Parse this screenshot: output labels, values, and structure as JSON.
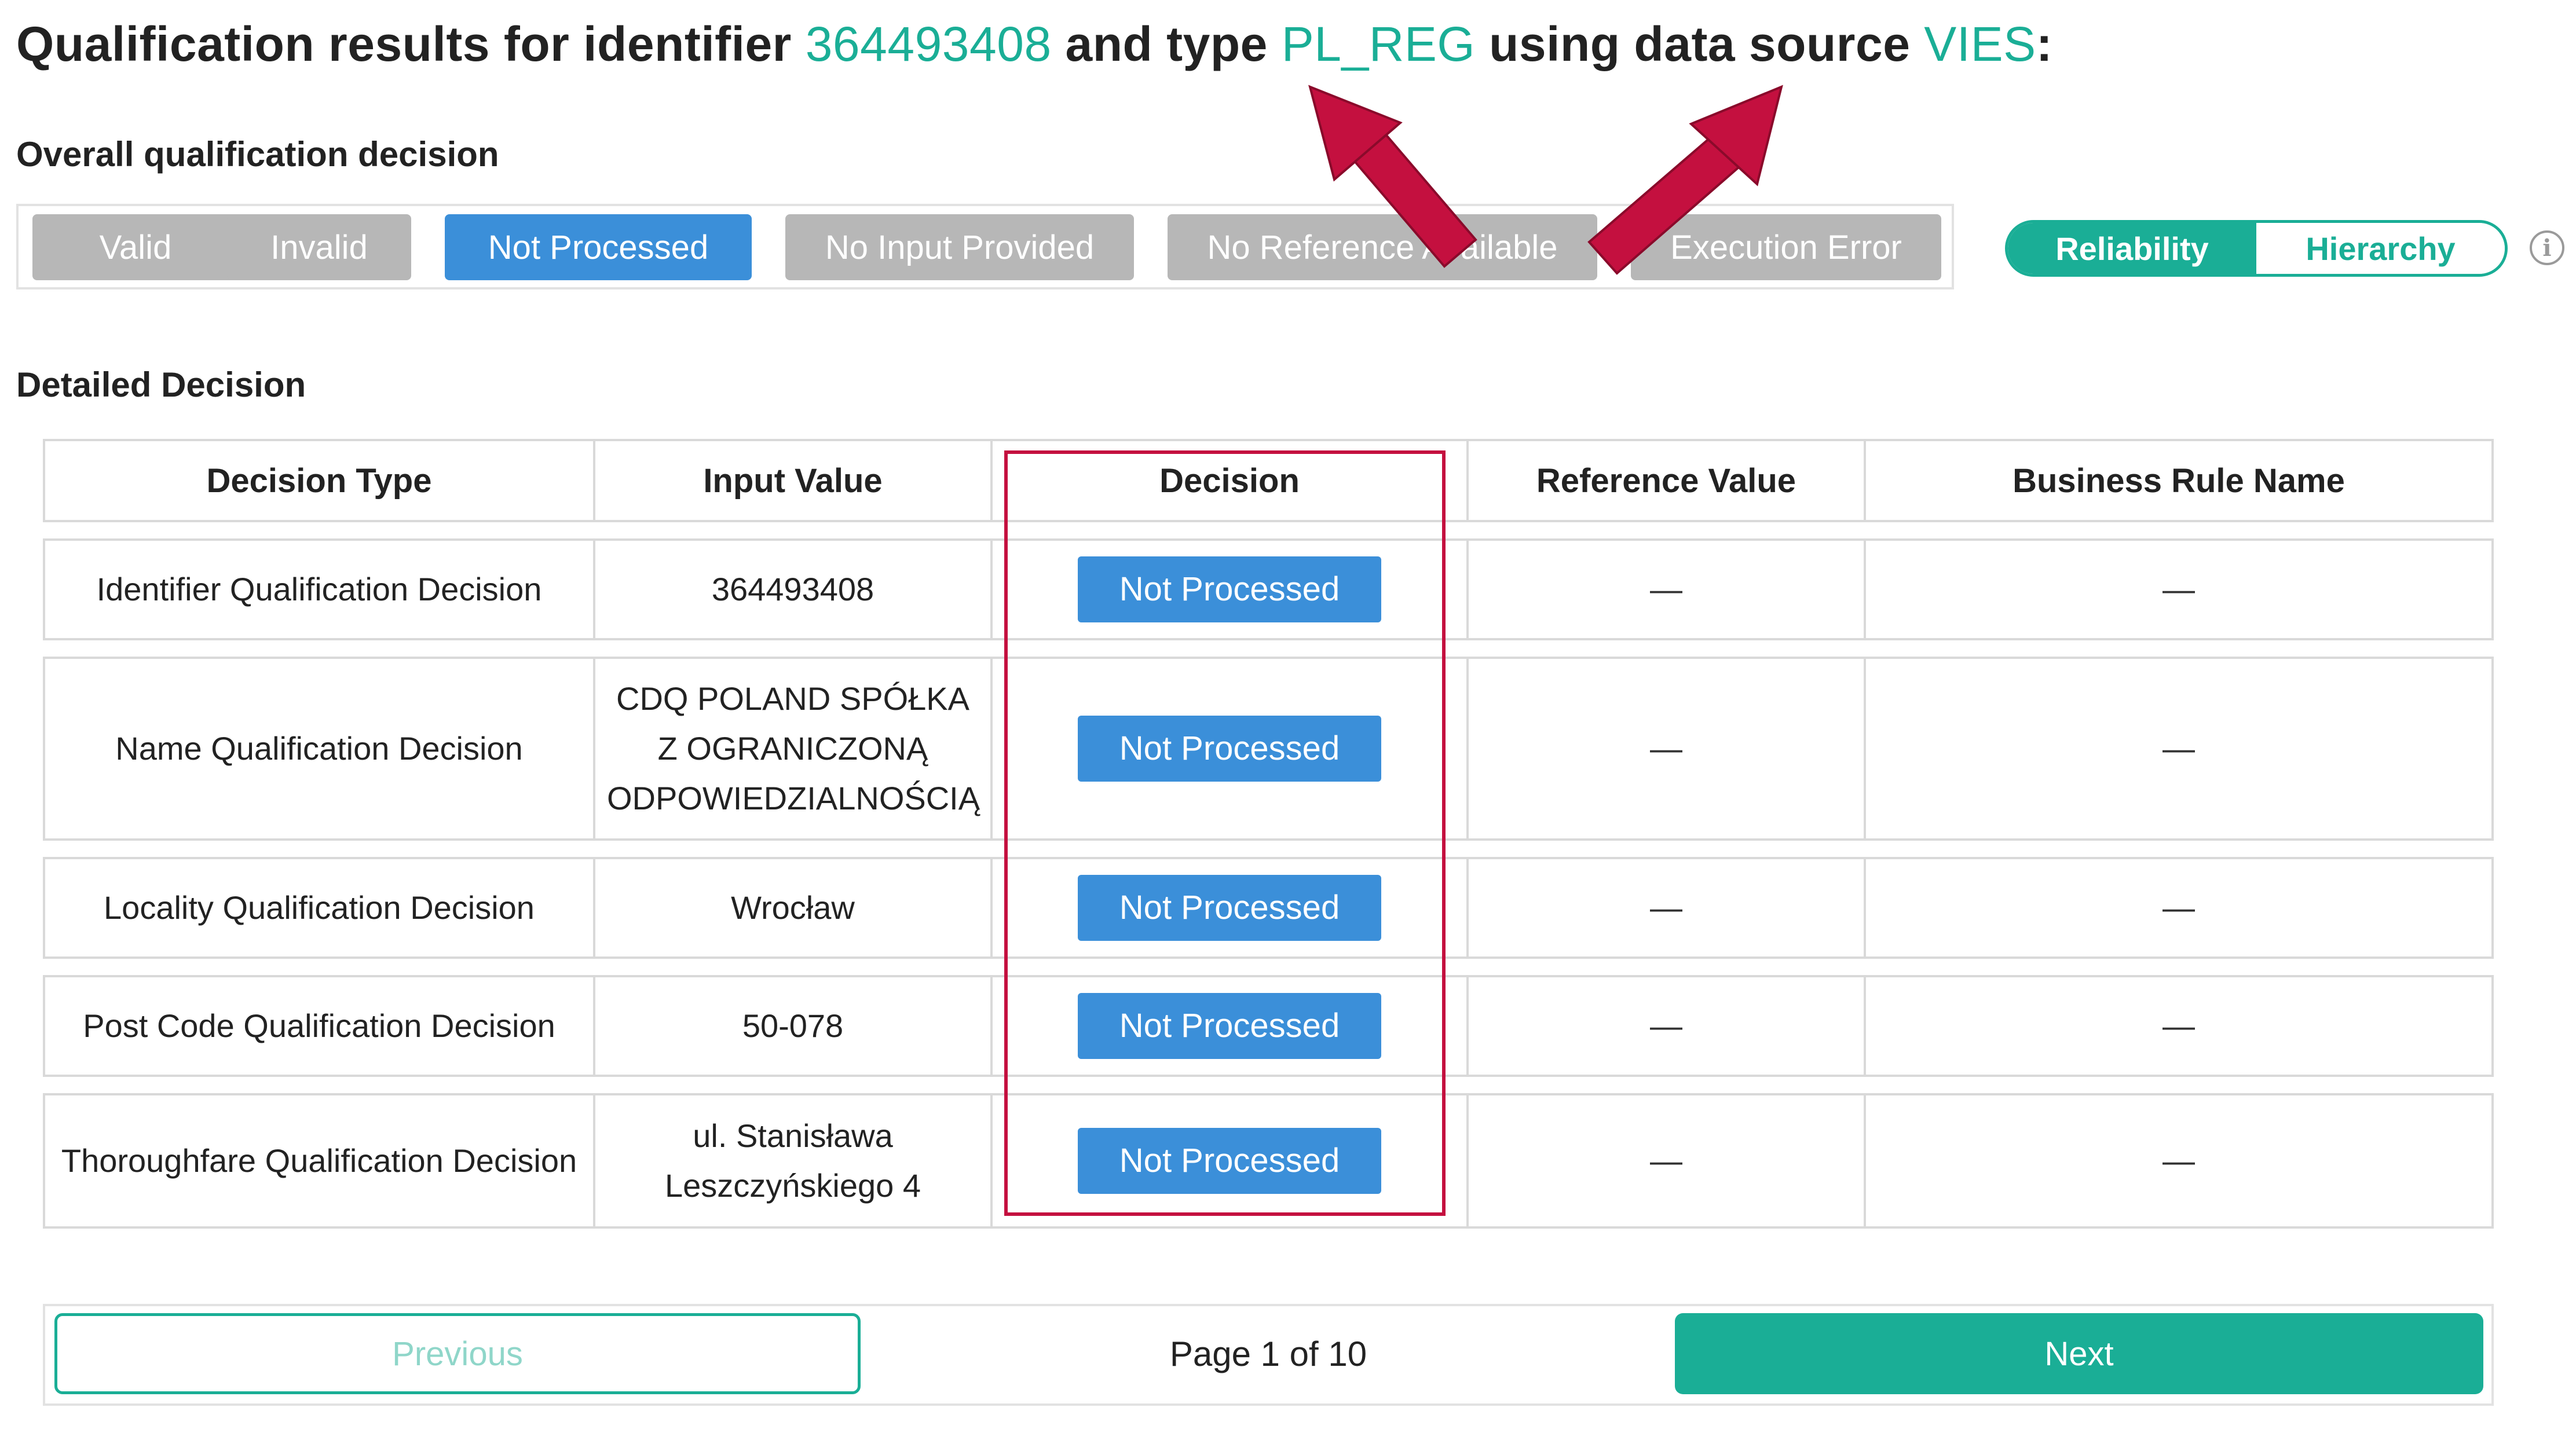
{
  "title": {
    "prefix": "Qualification results for identifier ",
    "identifier": "364493408",
    "mid1": " and type ",
    "type": "PL_REG",
    "mid2": " using data source ",
    "source": "VIES",
    "suffix": ":"
  },
  "overall": {
    "heading": "Overall qualification decision",
    "chips": [
      {
        "label": "Valid",
        "active": false
      },
      {
        "label": "Invalid",
        "active": false
      },
      {
        "label": "Not Processed",
        "active": true
      },
      {
        "label": "No Input Provided",
        "active": false
      },
      {
        "label": "No Reference Available",
        "active": false
      },
      {
        "label": "Execution Error",
        "active": false
      }
    ],
    "toggle": {
      "reliability": "Reliability",
      "hierarchy": "Hierarchy",
      "selected": "Reliability"
    },
    "info_icon": "info-icon"
  },
  "detailed": {
    "heading": "Detailed Decision",
    "columns": [
      "Decision Type",
      "Input Value",
      "Decision",
      "Reference Value",
      "Business Rule Name"
    ],
    "rows": [
      {
        "type": "Identifier Qualification Decision",
        "input": [
          "364493408"
        ],
        "decision": "Not Processed",
        "reference": "—",
        "rule": "—"
      },
      {
        "type": "Name Qualification Decision",
        "input": [
          "CDQ POLAND SPÓŁKA",
          "Z OGRANICZONĄ",
          "ODPOWIEDZIALNOŚCIĄ"
        ],
        "decision": "Not Processed",
        "reference": "—",
        "rule": "—"
      },
      {
        "type": "Locality Qualification Decision",
        "input": [
          "Wrocław"
        ],
        "decision": "Not Processed",
        "reference": "—",
        "rule": "—"
      },
      {
        "type": "Post Code Qualification Decision",
        "input": [
          "50-078"
        ],
        "decision": "Not Processed",
        "reference": "—",
        "rule": "—"
      },
      {
        "type": "Thoroughfare Qualification Decision",
        "input": [
          "ul. Stanisława",
          "Leszczyńskiego 4"
        ],
        "decision": "Not Processed",
        "reference": "—",
        "rule": "—"
      }
    ]
  },
  "pagination": {
    "previous": "Previous",
    "page_text": "Page 1 of 10",
    "next": "Next"
  },
  "colors": {
    "accent": "#1aae96",
    "active_chip": "#3b8fd9",
    "inactive_chip": "#b7b7b7",
    "annotation": "#c4103f"
  }
}
